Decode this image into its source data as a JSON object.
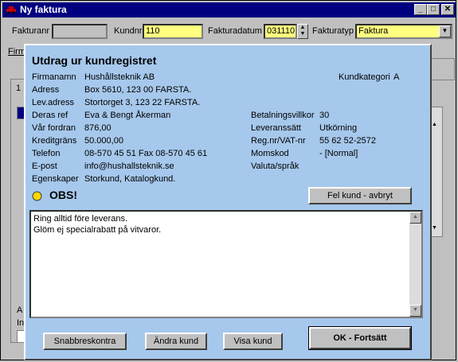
{
  "window": {
    "title": "Ny faktura"
  },
  "header": {
    "fakturanr_label": "Fakturanr",
    "fakturanr_value": "",
    "kundnr_label": "Kundnr",
    "kundnr_value": "110",
    "fakturadatum_label": "Fakturadatum",
    "fakturadatum_value": "031110",
    "fakturatyp_label": "Fakturatyp",
    "fakturatyp_value": "Faktura"
  },
  "background": {
    "firm_partial": "Firm",
    "num_partial": "1",
    "a_partial": "A",
    "in_partial": "In"
  },
  "dialog": {
    "title": "Utdrag ur kundregistret",
    "left_labels": [
      "Firmanamn",
      "Adress",
      "Lev.adress",
      "Deras ref",
      "Vår fordran",
      "Kreditgräns",
      "Telefon",
      "E-post",
      "Egenskaper"
    ],
    "left_values": [
      "Hushållsteknik AB",
      "Box 5610, 123 00  FARSTA.",
      "Stortorget 3, 123 22  FARSTA.",
      "Eva & Bengt Åkerman",
      "876,00",
      "50.000,00",
      "08-570 45 51    Fax 08-570 45 61",
      "info@hushallsteknik.se",
      "Storkund, Katalogkund."
    ],
    "kundkategori_label": "Kundkategori",
    "kundkategori_value": "A",
    "right_labels": [
      "Betalningsvillkor",
      "Leveranssätt",
      "Reg.nr/VAT-nr",
      "Momskod",
      "Valuta/språk"
    ],
    "right_values": [
      "30",
      "Utkörning",
      "55 62 52-2572",
      "- [Normal]",
      ""
    ],
    "obs_label": "OBS!",
    "wrong_customer_button": "Fel kund - avbryt",
    "memo_lines": [
      "Ring alltid före leverans.",
      "Glöm ej specialrabatt på vitvaror."
    ],
    "buttons": {
      "quick_register": "Snabbreskontra",
      "edit_customer": "Ändra kund",
      "show_customer": "Visa kund",
      "ok_continue": "OK - Fortsätt"
    },
    "colors": {
      "background": "#a6c8ec",
      "obs_light": "#ffd700"
    }
  }
}
